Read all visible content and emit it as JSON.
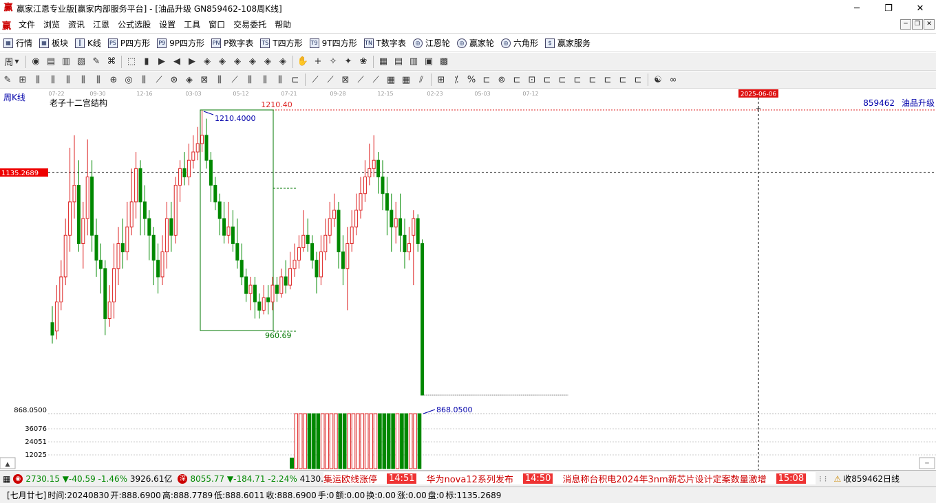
{
  "window": {
    "app_logo": "赢",
    "title": "赢家江恩专业版[赢家内部服务平台] - [油品升级  GN859462-108周K线]",
    "min": "─",
    "max": "❐",
    "close": "✕"
  },
  "menu": {
    "items": [
      "文件",
      "浏览",
      "资讯",
      "江恩",
      "公式选股",
      "设置",
      "工具",
      "窗口",
      "交易委托",
      "帮助"
    ]
  },
  "toolbar1": {
    "items": [
      {
        "label": "行情",
        "icon": "grid-icon",
        "glyph": "▦"
      },
      {
        "label": "板块",
        "icon": "blocks-icon",
        "glyph": "▦"
      },
      {
        "label": "K线",
        "icon": "candle-icon",
        "glyph": "┃"
      },
      {
        "label": "P四方形",
        "icon": "ps-icon",
        "glyph": "PS"
      },
      {
        "label": "9P四方形",
        "icon": "p9-icon",
        "glyph": "P9"
      },
      {
        "label": "P数字表",
        "icon": "pn-icon",
        "glyph": "PN"
      },
      {
        "label": "T四方形",
        "icon": "ts-icon",
        "glyph": "TS"
      },
      {
        "label": "9T四方形",
        "icon": "t9-icon",
        "glyph": "T9"
      },
      {
        "label": "T数字表",
        "icon": "tn-icon",
        "glyph": "TN"
      },
      {
        "label": "江恩轮",
        "icon": "gann-wheel-icon",
        "glyph": "◎"
      },
      {
        "label": "赢家轮",
        "icon": "winner-wheel-icon",
        "glyph": "◎"
      },
      {
        "label": "六角形",
        "icon": "hexagon-icon",
        "glyph": "◎"
      },
      {
        "label": "赢家服务",
        "icon": "dollar-icon",
        "glyph": "$"
      }
    ]
  },
  "toolbar2": {
    "period_label": "周",
    "tools": [
      "◉",
      "▤",
      "▥",
      "▧",
      "✎",
      "⌘",
      "⬚",
      "▮",
      "▶",
      "◀",
      "▶",
      "◈",
      "◈",
      "◈",
      "◈",
      "◈",
      "◈",
      "✋",
      "+",
      "✧",
      "✦",
      "❀",
      "▦",
      "▤",
      "▥",
      "▣",
      "▩"
    ]
  },
  "toolbar3": {
    "tools": [
      "✎",
      "⊞",
      "⫼",
      "⫼",
      "⫼",
      "⫼",
      "⫼",
      "⊕",
      "◎",
      "⫼",
      "⟋",
      "⊛",
      "◈",
      "⊠",
      "⫼",
      "⟋",
      "⫼",
      "⫼",
      "⫼",
      "⊏",
      "⟋",
      "⟋",
      "⊠",
      "⟋",
      "⟋",
      "▦",
      "▦",
      "⫽",
      "⊞",
      "⁒",
      "%",
      "⊏",
      "⊚",
      "⊏",
      "⊡",
      "⊏",
      "⊏",
      "⊏",
      "⊏",
      "⊏",
      "⊏",
      "⊏",
      "☯",
      "∞"
    ]
  },
  "chart": {
    "period_label": "周K线",
    "indicator_name": "老子十二宫结构",
    "right_label_code": "859462",
    "right_label_name": "油品升级",
    "date_ticks": [
      "07-22",
      "09-30",
      "12-16",
      "03-03",
      "05-12",
      "07-21",
      "09-28",
      "12-15",
      "02-23",
      "05-03",
      "07-12"
    ],
    "cursor_date": "2025-06-06",
    "price_high_label": "1210.40",
    "box_high_label": "1210.4000",
    "box_low_label": "960.69",
    "crosshair_price": "1135.2689",
    "low_label": "868.0500",
    "vol_top_label": "868.0500",
    "vol_ticks": [
      "36076",
      "24051",
      "12025"
    ],
    "colors": {
      "up": "#d22",
      "down": "#080",
      "box": "#070",
      "cross": "#000",
      "price_tag": "#e00"
    }
  },
  "chart_data": {
    "type": "candlestick",
    "series": [
      {
        "values": [
          [
            955,
            940,
            975,
            930
          ],
          [
            945,
            980,
            1000,
            935
          ],
          [
            980,
            1010,
            1030,
            970
          ],
          [
            1010,
            1060,
            1080,
            1000
          ],
          [
            1060,
            1100,
            1165,
            1040
          ],
          [
            1100,
            1120,
            1180,
            1080
          ],
          [
            1120,
            1050,
            1150,
            1040
          ],
          [
            1050,
            1080,
            1100,
            1020
          ],
          [
            1080,
            1130,
            1175,
            1060
          ],
          [
            1130,
            1060,
            1150,
            1040
          ],
          [
            1060,
            1030,
            1080,
            1010
          ],
          [
            1030,
            1020,
            1050,
            990
          ],
          [
            1020,
            960,
            1030,
            940
          ],
          [
            960,
            980,
            1000,
            950
          ],
          [
            980,
            1020,
            1050,
            960
          ],
          [
            1020,
            1050,
            1070,
            1000
          ],
          [
            1050,
            1040,
            1080,
            1020
          ],
          [
            1040,
            1070,
            1100,
            1030
          ],
          [
            1070,
            1100,
            1140,
            1060
          ],
          [
            1100,
            1140,
            1160,
            1080
          ],
          [
            1140,
            1100,
            1150,
            1060
          ],
          [
            1100,
            1080,
            1120,
            1060
          ],
          [
            1080,
            1060,
            1090,
            1030
          ],
          [
            1060,
            1030,
            1070,
            1000
          ],
          [
            1030,
            1010,
            1050,
            990
          ],
          [
            1010,
            1040,
            1060,
            1000
          ],
          [
            1040,
            1080,
            1100,
            1020
          ],
          [
            1080,
            1060,
            1100,
            1040
          ],
          [
            1060,
            1120,
            1130,
            1050
          ],
          [
            1120,
            1140,
            1150,
            1100
          ],
          [
            1140,
            1130,
            1160,
            1120
          ],
          [
            1130,
            1150,
            1170,
            1120
          ],
          [
            1150,
            1160,
            1180,
            1140
          ],
          [
            1160,
            1170,
            1190,
            1150
          ],
          [
            1170,
            1180,
            1210,
            1160
          ],
          [
            1180,
            1150,
            1200,
            1140
          ],
          [
            1150,
            1120,
            1160,
            1100
          ],
          [
            1120,
            1100,
            1130,
            1090
          ],
          [
            1100,
            1080,
            1110,
            1060
          ],
          [
            1080,
            1060,
            1100,
            1050
          ],
          [
            1060,
            1070,
            1100,
            1050
          ],
          [
            1070,
            1050,
            1090,
            1040
          ],
          [
            1050,
            1030,
            1080,
            1020
          ],
          [
            1030,
            1010,
            1050,
            1000
          ],
          [
            1010,
            990,
            1020,
            980
          ],
          [
            990,
            1000,
            1010,
            970
          ],
          [
            1000,
            980,
            1010,
            960
          ],
          [
            980,
            970,
            990,
            960
          ],
          [
            970,
            985,
            1000,
            965
          ],
          [
            985,
            980,
            1000,
            965
          ],
          [
            980,
            1000,
            1010,
            970
          ],
          [
            1000,
            990,
            1010,
            980
          ],
          [
            990,
            1010,
            1020,
            985
          ],
          [
            1010,
            1000,
            1030,
            990
          ],
          [
            1000,
            1020,
            1040,
            995
          ],
          [
            1020,
            1030,
            1050,
            1010
          ],
          [
            1030,
            1045,
            1060,
            1020
          ],
          [
            1045,
            1060,
            1090,
            1040
          ],
          [
            1060,
            1050,
            1080,
            1040
          ],
          [
            1050,
            1030,
            1060,
            1020
          ],
          [
            1030,
            1010,
            1040,
            990
          ],
          [
            1010,
            1040,
            1060,
            1000
          ],
          [
            1040,
            1060,
            1080,
            1030
          ],
          [
            1060,
            1080,
            1100,
            1050
          ],
          [
            1080,
            1090,
            1110,
            1070
          ],
          [
            1090,
            1040,
            1100,
            1020
          ],
          [
            1040,
            1020,
            1060,
            1000
          ],
          [
            1020,
            1050,
            1070,
            970
          ],
          [
            1050,
            1070,
            1090,
            1040
          ],
          [
            1070,
            1090,
            1110,
            1060
          ],
          [
            1090,
            1110,
            1130,
            1080
          ],
          [
            1110,
            1130,
            1150,
            1100
          ],
          [
            1130,
            1140,
            1170,
            1120
          ],
          [
            1140,
            1150,
            1180,
            1130
          ],
          [
            1150,
            1130,
            1160,
            1110
          ],
          [
            1130,
            1110,
            1150,
            1090
          ],
          [
            1110,
            1090,
            1130,
            1060
          ],
          [
            1090,
            1070,
            1110,
            1040
          ],
          [
            1070,
            1080,
            1100,
            1050
          ],
          [
            1080,
            1060,
            1110,
            1040
          ],
          [
            1060,
            1040,
            1080,
            1020
          ],
          [
            1040,
            1050,
            1070,
            1030
          ],
          [
            1060,
            1080,
            1090,
            1000
          ],
          [
            1080,
            1050,
            1085,
            1040
          ],
          [
            1050,
            868.05,
            1055,
            868.05
          ]
        ]
      },
      {
        "name": "volume",
        "values": [
          0,
          0,
          0,
          0,
          0,
          0,
          0,
          0,
          0,
          0,
          0,
          0,
          0,
          0,
          0,
          0,
          0,
          0,
          0,
          0,
          0,
          0,
          0,
          0,
          0,
          0,
          0,
          0,
          0,
          0,
          0,
          0,
          0,
          0,
          0,
          0,
          0,
          0,
          0,
          0,
          0,
          0,
          0,
          0,
          0,
          0,
          0,
          0,
          0,
          0,
          0,
          0,
          0,
          0,
          0,
          0,
          0,
          0,
          0,
          0,
          0,
          0,
          0,
          0,
          0,
          0,
          0,
          0,
          0,
          0,
          0,
          0,
          0,
          0,
          0,
          0,
          0,
          0,
          0,
          0,
          0,
          0,
          0,
          0,
          0
        ]
      }
    ],
    "ylim": [
      868.05,
      1210.4
    ]
  },
  "status": {
    "idx1_value": "2730.15",
    "idx1_change": "▼-40.59",
    "idx1_pct": "-1.46%",
    "idx1_amount": "3926.61亿",
    "idx2_icon": "深",
    "idx2_value": "8055.77",
    "idx2_change": "▼-184.71",
    "idx2_pct": "-2.24%",
    "idx2_amount": "4130.26",
    "news": [
      {
        "text": "集运欧线涨停"
      },
      {
        "time": "14:51",
        "text": "华为nova12系列发布"
      },
      {
        "time": "14:50",
        "text": "消息称台积电2024年3nm新芯片设计定案数量激增"
      },
      {
        "time": "15:08",
        "text": ""
      }
    ],
    "right_text": "收859462日线"
  },
  "info": {
    "lunar": "[七月廿七]",
    "time": "时间:20240830",
    "open": "开:888.6900",
    "high": "高:888.7789",
    "low": "低:888.6011",
    "close": "收:888.6900",
    "hand": "手:0",
    "amount": "额:0.00",
    "turnover": "换:0.00",
    "change": "涨:0.00",
    "disk": "盘:0",
    "mark": "标:1135.2689"
  }
}
